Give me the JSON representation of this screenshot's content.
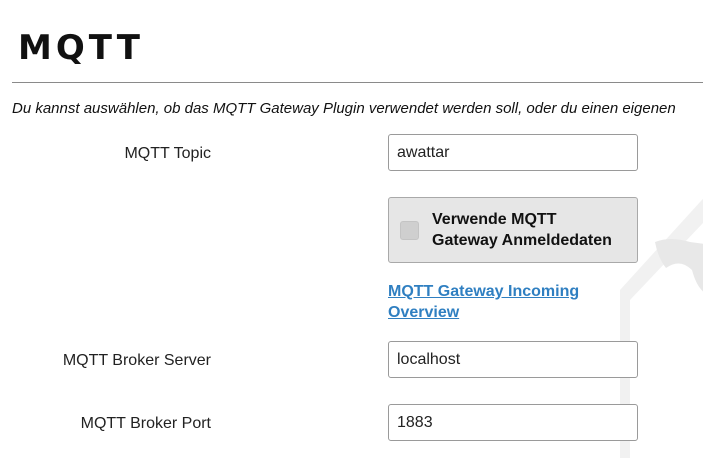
{
  "header": {
    "title": "MQTT"
  },
  "intro_text": "Du kannst auswählen, ob das MQTT Gateway Plugin verwendet werden soll, oder du einen eigenen",
  "form": {
    "topic": {
      "label": "MQTT Topic",
      "value": "awattar"
    },
    "use_gateway_credentials": {
      "label_line1": "Verwende MQTT",
      "label_line2": "Gateway Anmeldedaten",
      "checked": false
    },
    "gateway_link": {
      "line1": "MQTT Gateway Incoming",
      "line2": "Overview"
    },
    "broker_server": {
      "label": "MQTT Broker Server",
      "value": "localhost"
    },
    "broker_port": {
      "label": "MQTT Broker Port",
      "value": "1883"
    }
  },
  "colors": {
    "link": "#2f7fc1",
    "checkbox_background": "#e6e6e6",
    "watermark": "#efefef"
  },
  "icons": {
    "watermark": "house-mustache-watermark-icon"
  }
}
